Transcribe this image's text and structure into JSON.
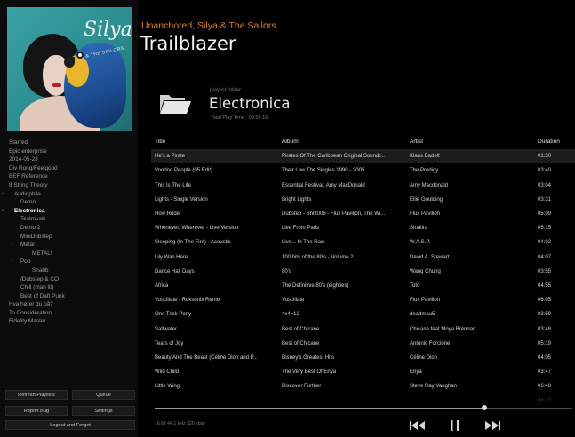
{
  "album_art": {
    "band_title": "Silya",
    "band_subtitle": "& THE SAILORS"
  },
  "now_playing": {
    "artist_line": "Unanchored, Silya & The Sailors",
    "title": "Trailblazer"
  },
  "playlist": {
    "kind_label": "playlist folder",
    "name": "Electronica",
    "total_play_time_label": "Total Play Time :",
    "total_play_time_value": "09:59:16"
  },
  "sidebar": {
    "tree": [
      {
        "label": "Starred",
        "indent": 0
      },
      {
        "label": "Epic enterprise",
        "indent": 0
      },
      {
        "label": "2014-05-23",
        "indent": 0
      },
      {
        "label": "Div Rong/Feelgood",
        "indent": 0
      },
      {
        "label": "BEF Reference",
        "indent": 0
      },
      {
        "label": "8 String Theory",
        "indent": 0
      },
      {
        "label": "Audiophile",
        "indent": 0,
        "toggle": "-"
      },
      {
        "label": "Demo",
        "indent": 1
      },
      {
        "label": "Electronica",
        "indent": 0,
        "toggle": "-",
        "active": true
      },
      {
        "label": "Testmusik",
        "indent": 1
      },
      {
        "label": "Demo 2",
        "indent": 1
      },
      {
        "label": "MiniDubstep",
        "indent": 1
      },
      {
        "label": "Metal",
        "indent": 1,
        "toggle": "-"
      },
      {
        "label": "METAL!",
        "indent": 2
      },
      {
        "label": "Pop",
        "indent": 1,
        "toggle": "-"
      },
      {
        "label": "Snabb",
        "indent": 2
      },
      {
        "label": "/Dubstep & CO",
        "indent": 1
      },
      {
        "label": "Chill (man lit)",
        "indent": 1
      },
      {
        "label": "Best of Daft Punk",
        "indent": 1
      },
      {
        "label": "Hva hører du på?",
        "indent": 0
      },
      {
        "label": "To Consideration",
        "indent": 0
      },
      {
        "label": "Fidelity Master",
        "indent": 0
      }
    ],
    "buttons": {
      "refresh": "Refresh Playlists",
      "queue": "Queue",
      "report_bug": "Report Bug",
      "settings": "Settings",
      "logout": "Logout and Forget"
    }
  },
  "table": {
    "columns": {
      "title": "Title",
      "album": "Album",
      "artist": "Artist",
      "duration": "Duration"
    },
    "rows": [
      {
        "title": "He's a Pirate",
        "album": "Pirates Of The Caribbean Original Soundt...",
        "artist": "Klaus Badelt",
        "duration": "01:30",
        "selected": true
      },
      {
        "title": "Voodoo People (05 Edit)",
        "album": "Their Law The Singles 1990 - 2005",
        "artist": "The Prodigy",
        "duration": "03:40"
      },
      {
        "title": "This Is The Life",
        "album": "Essential Festival. Amy MacDonald",
        "artist": "Amy Macdonald",
        "duration": "03:04"
      },
      {
        "title": "Lights - Single Version",
        "album": "Bright Lights",
        "artist": "Ellie Goulding",
        "duration": "03:31"
      },
      {
        "title": "How Rude",
        "album": "Dubstep - Shift006 - Flux Pavilion, The Wi...",
        "artist": "Flux Pavilion",
        "duration": "05:09"
      },
      {
        "title": "Whenever, Wherever - Live Version",
        "album": "Live From Paris",
        "artist": "Shakira",
        "duration": "05:15"
      },
      {
        "title": "Sleeping (In The Fire) - Acoustic",
        "album": "Live... In The Raw",
        "artist": "W.A.S.P.",
        "duration": "04:02"
      },
      {
        "title": "Lily Was Here",
        "album": "100 hits of the 80's - Volume 2",
        "artist": "David A. Stewart",
        "duration": "04:07"
      },
      {
        "title": "Dance Hall Days",
        "album": "80's",
        "artist": "Wang Chung",
        "duration": "03:55"
      },
      {
        "title": "Africa",
        "album": "The Definitive 80's (eighties)",
        "artist": "Toto",
        "duration": "04:55"
      },
      {
        "title": "Voscillate - Roksonix Remix",
        "album": "Voscillate",
        "artist": "Flux Pavilion",
        "duration": "06:05"
      },
      {
        "title": "One Trick Pony",
        "album": "4x4=12",
        "artist": "deadmau5",
        "duration": "03:59"
      },
      {
        "title": "Saltwater",
        "album": "Best of Chicane",
        "artist": "Chicane feat Moya Brennan",
        "duration": "03:48"
      },
      {
        "title": "Tears of Joy",
        "album": "Best of Chicane",
        "artist": "Antonio Forcione",
        "duration": "05:19"
      },
      {
        "title": "Beauty And The Beast (Céline Dion and P...",
        "album": "Disney's Greatest Hits",
        "artist": "Céline Dion",
        "duration": "04:05"
      },
      {
        "title": "Wild Child",
        "album": "The Very Best Of Enya",
        "artist": "Enya",
        "duration": "03:47"
      },
      {
        "title": "Little Wing",
        "album": "Discover Further",
        "artist": "Steve Ray Vaughan",
        "duration": "06:48"
      },
      {
        "title": "",
        "album": "",
        "artist": "",
        "duration": "04:17"
      }
    ]
  },
  "player": {
    "file_info": "16 bit 44.1 kHz   320 kbps",
    "progress_fraction": 0.79,
    "icons": {
      "previous": "previous-icon",
      "pause": "pause-icon",
      "next": "next-icon"
    }
  },
  "colors": {
    "accent": "#e07e2a",
    "background": "#000000",
    "sidebar": "#0c0c0c",
    "selected_row": "#1c1c1c"
  }
}
